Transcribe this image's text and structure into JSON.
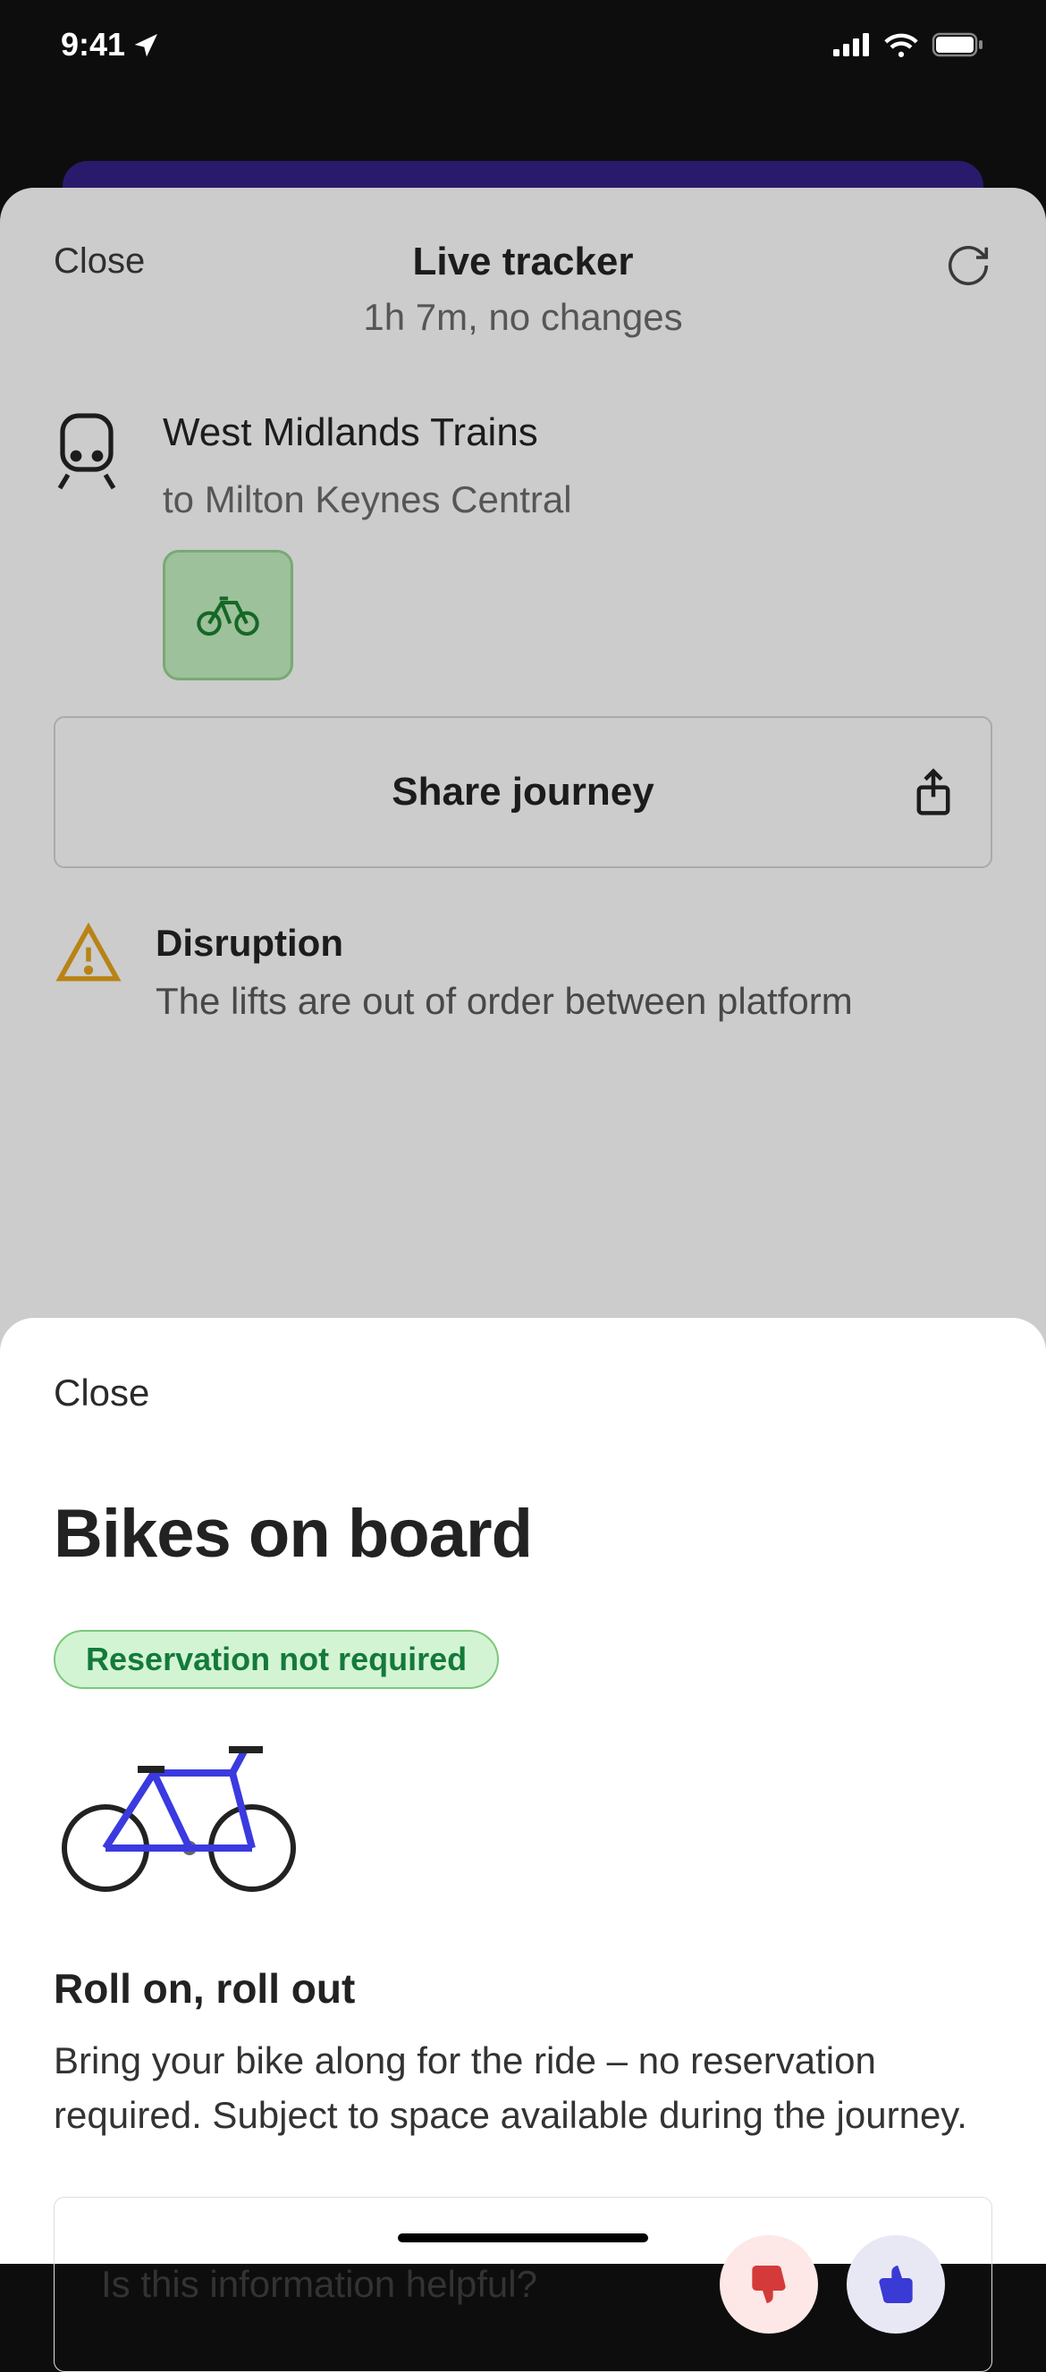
{
  "status": {
    "time": "9:41"
  },
  "tracker": {
    "close_label": "Close",
    "title": "Live tracker",
    "subtitle": "1h 7m, no changes",
    "operator": "West Midlands Trains",
    "destination": "to Milton Keynes Central",
    "share_label": "Share journey",
    "disruption": {
      "title": "Disruption",
      "text": "The lifts are out of order between platform"
    }
  },
  "bikes": {
    "close_label": "Close",
    "title": "Bikes on board",
    "badge": "Reservation not required",
    "section_title": "Roll on, roll out",
    "section_body": "Bring your bike along for the ride – no reservation required. Subject to space available during the journey.",
    "feedback_prompt": "Is this information helpful?"
  }
}
